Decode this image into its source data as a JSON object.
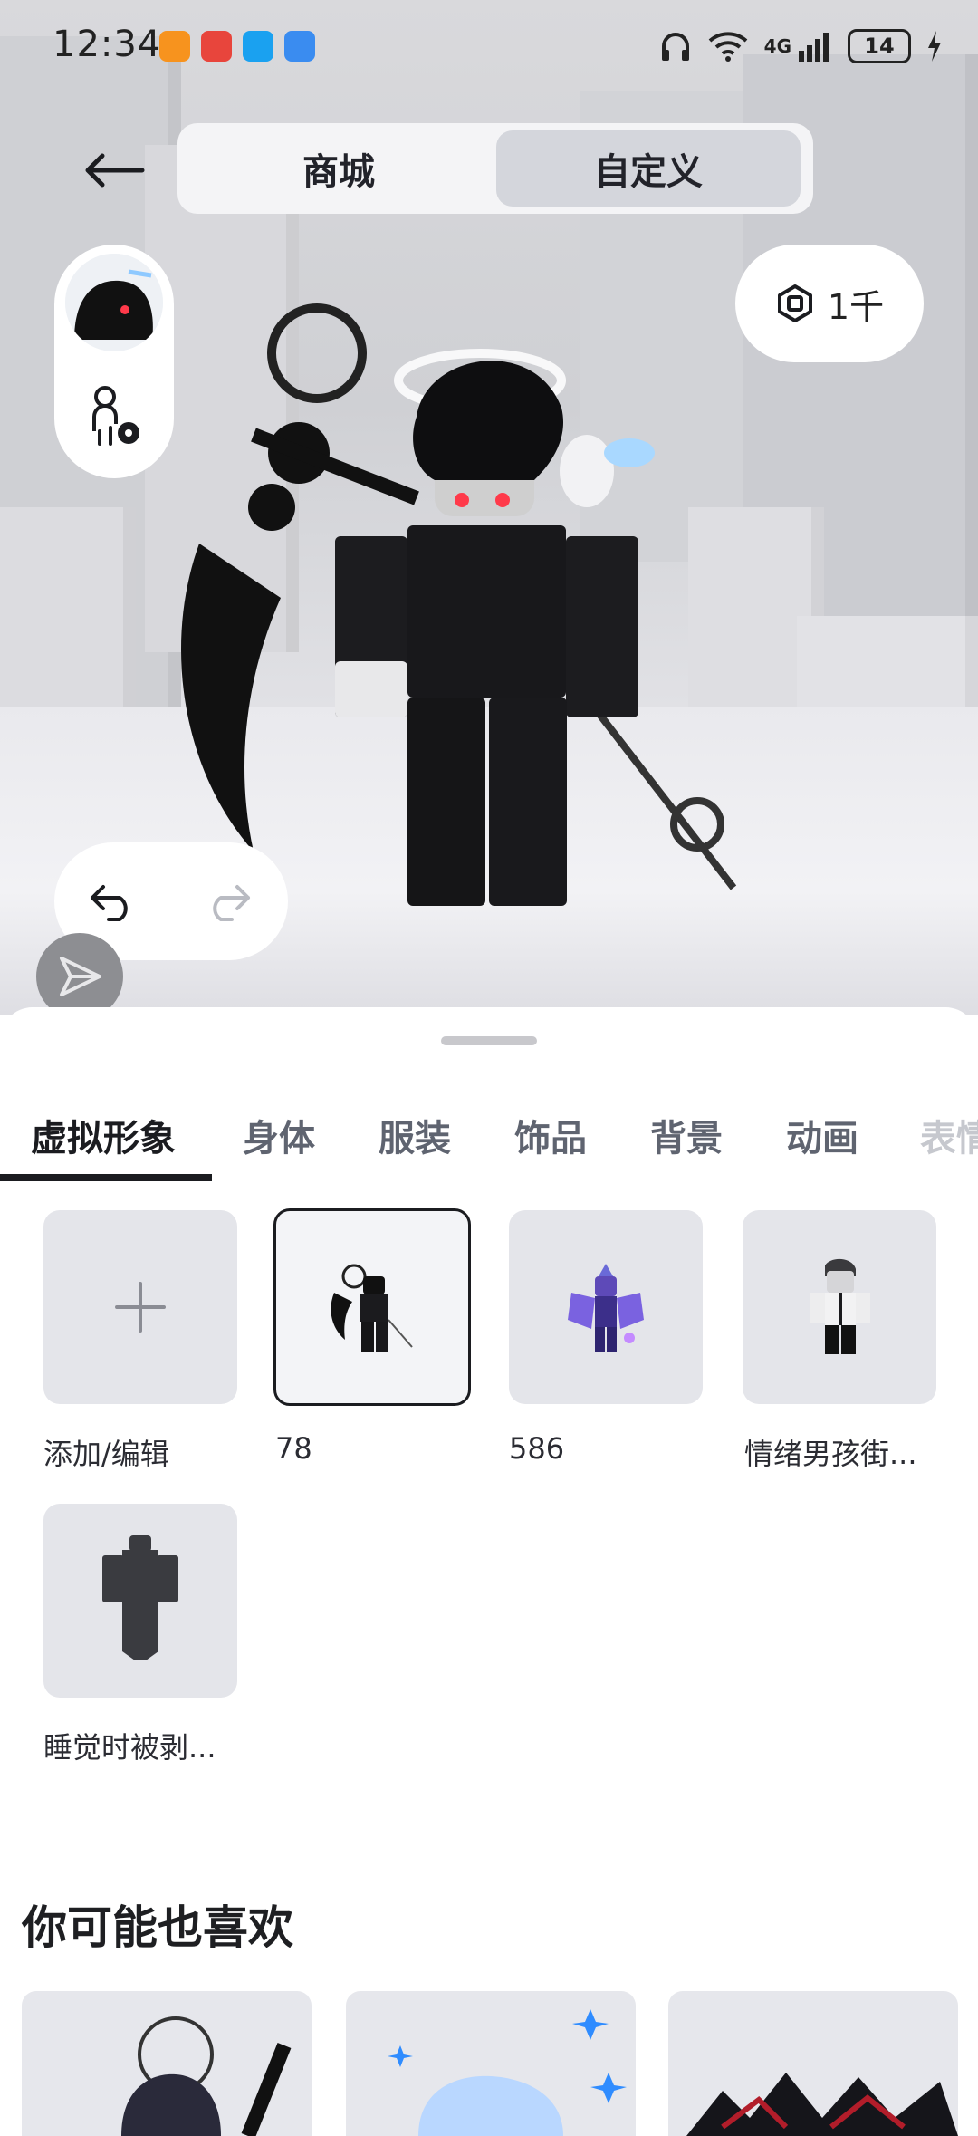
{
  "status_bar": {
    "time": "12:34",
    "battery": "14",
    "network": "4G"
  },
  "nav": {
    "tabs": [
      {
        "label": "商城"
      },
      {
        "label": "自定义"
      }
    ],
    "selected_tab": "自定义"
  },
  "robux": {
    "balance": "1千"
  },
  "categories": [
    {
      "label": "虚拟形象"
    },
    {
      "label": "身体"
    },
    {
      "label": "服装"
    },
    {
      "label": "饰品"
    },
    {
      "label": "背景"
    },
    {
      "label": "动画"
    },
    {
      "label": "表情"
    }
  ],
  "active_category": "虚拟形象",
  "outfits": [
    {
      "label": "添加/编辑"
    },
    {
      "label": "78"
    },
    {
      "label": "586"
    },
    {
      "label": "情绪男孩街..."
    },
    {
      "label": "睡觉时被剥..."
    }
  ],
  "selected_outfit": "78",
  "recommendations": {
    "title": "你可能也喜欢"
  },
  "colors": {
    "accent": "#1b1c20",
    "tab_inactive": "#5f6470",
    "tile_bg": "#e4e5ea"
  }
}
